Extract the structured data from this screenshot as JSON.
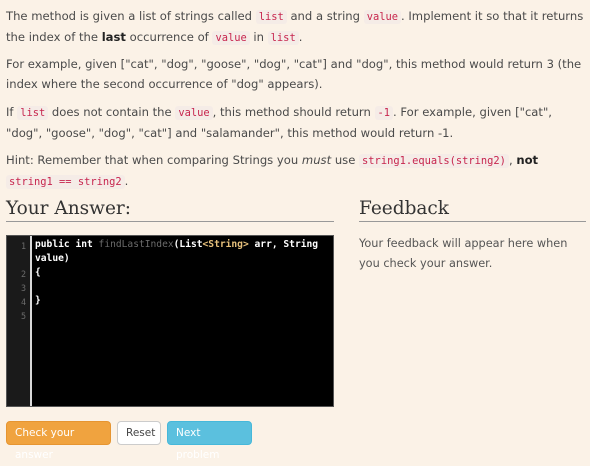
{
  "prompt": {
    "p1": {
      "t1": "The method is given a list of strings called ",
      "c1": "list",
      "t2": " and a string ",
      "c2": "value",
      "t3": ". Implement it so that it returns the index of the ",
      "bold": "last",
      "t4": " occurrence of ",
      "c3": "value",
      "t5": " in ",
      "c4": "list",
      "t6": "."
    },
    "p2": "For example, given [\"cat\", \"dog\", \"goose\", \"dog\", \"cat\"] and \"dog\", this method would return 3 (the index where the second occurrence of \"dog\" appears).",
    "p3": {
      "t1": "If ",
      "c1": "list",
      "t2": " does not contain the ",
      "c2": "value",
      "t3": ", this method should return ",
      "c3": "-1",
      "t4": ". For example, given [\"cat\", \"dog\", \"goose\", \"dog\", \"cat\"] and \"salamander\", this method would return -1."
    },
    "p4": {
      "t1": "Hint: Remember that when comparing Strings you ",
      "em": "must",
      "t2": " use ",
      "c1": "string1.equals(string2)",
      "t3": ", ",
      "not": "not",
      "t4": " ",
      "c2": "string1 == string2",
      "t5": "."
    }
  },
  "answer": {
    "heading": "Your Answer:",
    "lines": [
      {
        "num": "1",
        "kw1": "public",
        "kw2": "int",
        "fn": "findLastIndex",
        "rest1": "(List",
        "ty": "<String>",
        "rest2": " arr, String"
      },
      {
        "cont": "value)"
      },
      {
        "num": "2",
        "text": "{"
      },
      {
        "num": "3",
        "text": ""
      },
      {
        "num": "4",
        "text": "}"
      },
      {
        "num": "5",
        "text": ""
      }
    ]
  },
  "feedback": {
    "heading": "Feedback",
    "text": "Your feedback will appear here when you check your answer."
  },
  "buttons": {
    "check": "Check your answer",
    "reset": "Reset",
    "next": "Next problem"
  }
}
